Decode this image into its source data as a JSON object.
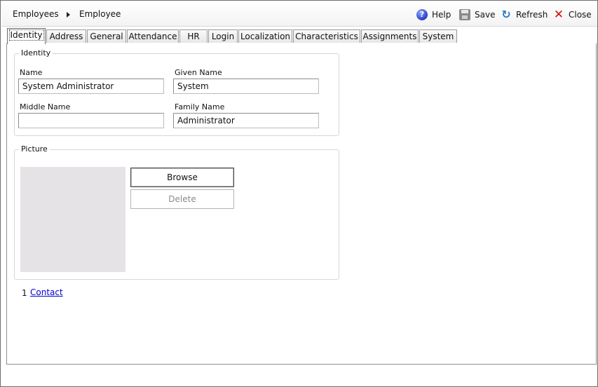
{
  "breadcrumb": {
    "parent": "Employees",
    "current": "Employee"
  },
  "toolbar": {
    "help": "Help",
    "save": "Save",
    "refresh": "Refresh",
    "close": "Close"
  },
  "icons": {
    "help": "help-icon",
    "save": "save-icon",
    "refresh": "refresh-icon",
    "close": "close-icon",
    "separator": "chevron-right-icon"
  },
  "tabs": [
    {
      "label": "Identity",
      "active": true
    },
    {
      "label": "Address"
    },
    {
      "label": "General"
    },
    {
      "label": "Attendance"
    },
    {
      "label": "HR"
    },
    {
      "label": "Login"
    },
    {
      "label": "Localization"
    },
    {
      "label": "Characteristics"
    },
    {
      "label": "Assignments"
    },
    {
      "label": "System"
    }
  ],
  "identity": {
    "title": "Identity",
    "name_label": "Name",
    "name_value": "System Administrator",
    "given_name_label": "Given Name",
    "given_name_value": "System",
    "middle_name_label": "Middle Name",
    "middle_name_value": "",
    "family_name_label": "Family Name",
    "family_name_value": "Administrator"
  },
  "picture": {
    "title": "Picture",
    "browse": "Browse",
    "delete": "Delete"
  },
  "contact": {
    "number": "1",
    "label": "Contact"
  },
  "colors": {
    "picture_placeholder": "#e6e3e6",
    "link": "#0000cc",
    "help_icon": "#2c3fc7",
    "close_icon": "#d01010",
    "refresh_icon": "#2c78c8"
  }
}
